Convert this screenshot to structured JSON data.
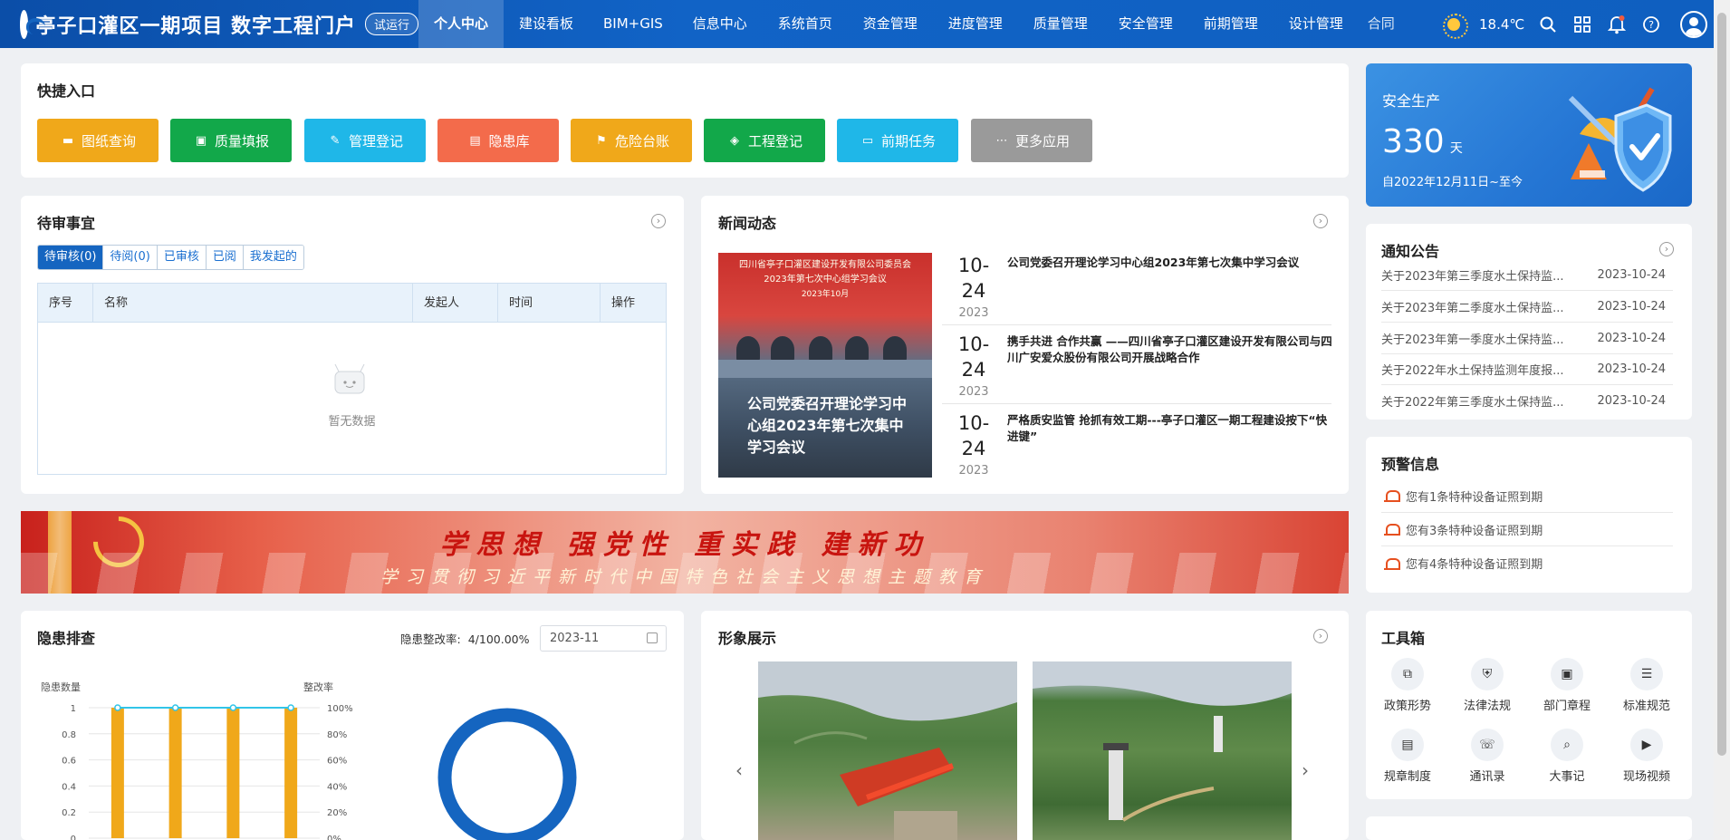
{
  "header": {
    "title": "亭子口灌区一期项目  数字工程门户",
    "badge": "试运行",
    "nav": [
      "个人中心",
      "建设看板",
      "BIM+GIS",
      "信息中心",
      "系统首页",
      "资金管理",
      "进度管理",
      "质量管理",
      "安全管理",
      "前期管理",
      "设计管理",
      "合同"
    ],
    "active_nav": "个人中心",
    "temperature": "18.4℃",
    "icons": [
      "sun-icon",
      "search-icon",
      "grid-icon",
      "bell-icon",
      "help-icon",
      "avatar-icon"
    ]
  },
  "quick": {
    "title": "快捷入口",
    "items": [
      {
        "label": "图纸查询",
        "color": "#f0a81a",
        "icon": "folder-icon"
      },
      {
        "label": "质量填报",
        "color": "#12a84a",
        "icon": "id-card-icon"
      },
      {
        "label": "管理登记",
        "color": "#1fb7e8",
        "icon": "edit-doc-icon"
      },
      {
        "label": "隐患库",
        "color": "#f36b4b",
        "icon": "chart-doc-icon"
      },
      {
        "label": "危险台账",
        "color": "#f0a81a",
        "icon": "flag-doc-icon"
      },
      {
        "label": "工程登记",
        "color": "#12a84a",
        "icon": "layers-icon"
      },
      {
        "label": "前期任务",
        "color": "#1fb7e8",
        "icon": "briefcase-icon"
      },
      {
        "label": "更多应用",
        "color": "#9a9a9a",
        "icon": "more-dots-icon"
      }
    ]
  },
  "pending": {
    "title": "待审事宜",
    "tabs": [
      "待审核(0)",
      "待阅(0)",
      "已审核",
      "已阅",
      "我发起的"
    ],
    "columns": [
      "序号",
      "名称",
      "发起人",
      "时间",
      "操作"
    ],
    "empty": "暂无数据"
  },
  "news": {
    "title": "新闻动态",
    "image_caption": "公司党委召开理论学习中心组2023年第七次集中学习会议",
    "image_banner": [
      "四川省亭子口灌区建设开发有限公司委员会",
      "2023年第七次中心组学习会议",
      "2023年10月"
    ],
    "items": [
      {
        "md": "10-24",
        "year": "2023",
        "text": "公司党委召开理论学习中心组2023年第七次集中学习会议"
      },
      {
        "md": "10-24",
        "year": "2023",
        "text": "携手共进 合作共赢 ——四川省亭子口灌区建设开发有限公司与四川广安爱众股份有限公司开展战略合作"
      },
      {
        "md": "10-24",
        "year": "2023",
        "text": "严格质安监管 抢抓有效工期---亭子口灌区一期工程建设按下“快进键”"
      }
    ]
  },
  "safety": {
    "title": "安全生产",
    "days": "330",
    "unit": "天",
    "since": "自2022年12月11日~至今"
  },
  "notices": {
    "title": "通知公告",
    "items": [
      {
        "text": "关于2023年第三季度水土保持监...",
        "date": "2023-10-24"
      },
      {
        "text": "关于2023年第二季度水土保持监...",
        "date": "2023-10-24"
      },
      {
        "text": "关于2023年第一季度水土保持监...",
        "date": "2023-10-24"
      },
      {
        "text": "关于2022年水土保持监测年度报...",
        "date": "2023-10-24"
      },
      {
        "text": "关于2022年第三季度水土保持监...",
        "date": "2023-10-24"
      }
    ]
  },
  "warnings": {
    "title": "预警信息",
    "items": [
      "您有1条特种设备证照到期",
      "您有3条特种设备证照到期",
      "您有4条特种设备证照到期"
    ]
  },
  "banner": {
    "main": "学思想 强党性 重实践 建新功",
    "sub": "学习贯彻习近平新时代中国特色社会主义思想主题教育"
  },
  "hazard": {
    "title": "隐患排查",
    "rate_label": "隐患整改率:",
    "rate_value": "4/100.00%",
    "month": "2023-11"
  },
  "chart_data": {
    "type": "bar",
    "categories": [
      "",
      "",
      "",
      ""
    ],
    "series": [
      {
        "type": "bar",
        "values": [
          1,
          1,
          1,
          1
        ],
        "color": "#f0a81a"
      },
      {
        "type": "line",
        "values": [
          100,
          100,
          100,
          100
        ],
        "color": "#31c5e8"
      }
    ],
    "ylabel": "隐患数量",
    "y2label": "整改率",
    "yticks": [
      "1",
      "0.8",
      "0.6",
      "0.4",
      "0.2",
      "0"
    ],
    "y2ticks": [
      "100%",
      "80%",
      "60%",
      "40%",
      "20%",
      "0%"
    ],
    "ylim": [
      0,
      1
    ],
    "y2lim": [
      0,
      100
    ],
    "donut_color": "#1565c0"
  },
  "gallery": {
    "title": "形象展示"
  },
  "tools": {
    "title": "工具箱",
    "items": [
      {
        "label": "政策形势",
        "icon": "org-chart-icon"
      },
      {
        "label": "法律法规",
        "icon": "shield-law-icon"
      },
      {
        "label": "部门章程",
        "icon": "id-badge-icon"
      },
      {
        "label": "标准规范",
        "icon": "checklist-icon"
      },
      {
        "label": "规章制度",
        "icon": "rules-doc-icon"
      },
      {
        "label": "通讯录",
        "icon": "contacts-icon"
      },
      {
        "label": "大事记",
        "icon": "record-search-icon"
      },
      {
        "label": "现场视频",
        "icon": "video-doc-icon"
      }
    ]
  }
}
